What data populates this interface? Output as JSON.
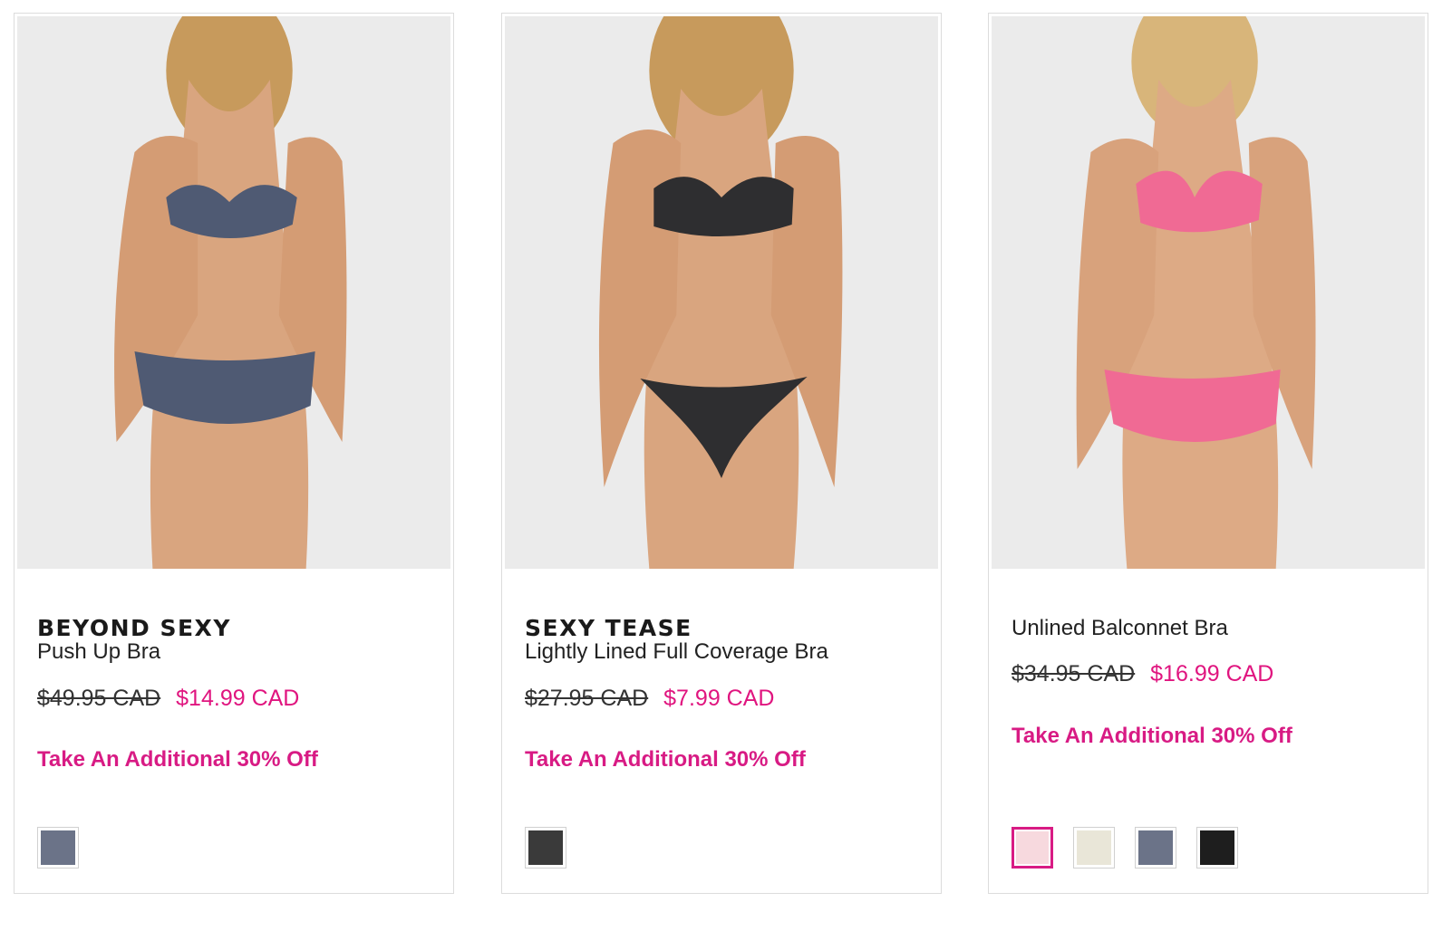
{
  "products": [
    {
      "brand": "BEYOND SEXY",
      "name": "Push Up Bra",
      "old_price": "$49.95 CAD",
      "sale_price": "$14.99 CAD",
      "promo": "Take An Additional 30% Off",
      "garment_color": "#4f5a73",
      "swatches": [
        {
          "icon": "grey-lace-swatch",
          "color": "#6b7388",
          "selected": true
        }
      ]
    },
    {
      "brand": "SEXY TEASE",
      "name": "Lightly Lined Full Coverage Bra",
      "old_price": "$27.95 CAD",
      "sale_price": "$7.99 CAD",
      "promo": "Take An Additional 30% Off",
      "garment_color": "#2e2e30",
      "swatches": [
        {
          "icon": "black-stripe-swatch",
          "color": "#3a3a3a",
          "selected": true
        }
      ]
    },
    {
      "brand": "",
      "name": "Unlined Balconnet Bra",
      "old_price": "$34.95 CAD",
      "sale_price": "$16.99 CAD",
      "promo": "Take An Additional 30% Off",
      "garment_color": "#f06a94",
      "swatches": [
        {
          "icon": "pink-swatch",
          "color": "#f7d9de",
          "selected": true
        },
        {
          "icon": "ivory-floral-swatch",
          "color": "#e9e6d8",
          "selected": false
        },
        {
          "icon": "grey-lace-swatch",
          "color": "#6b7388",
          "selected": false
        },
        {
          "icon": "black-lace-swatch",
          "color": "#1e1e1e",
          "selected": false
        }
      ]
    }
  ],
  "colors": {
    "accent": "#d81b84",
    "sale": "#e0157f",
    "image_bg": "#ebebeb",
    "skin": "#d9a57f",
    "hair": "#c79a5c"
  }
}
